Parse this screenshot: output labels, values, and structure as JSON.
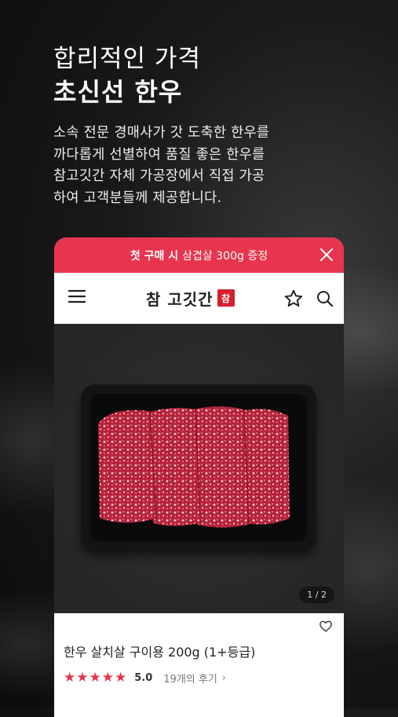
{
  "hero": {
    "subtitle": "합리적인 가격",
    "title": "초신선 한우",
    "description": [
      "소속 전문 경매사가 갓 도축한 한우를",
      "까다롭게 선별하여 품질 좋은 한우를",
      "참고깃간 자체 가공장에서 직접 가공",
      "하여 고객분들께 제공합니다."
    ]
  },
  "promo": {
    "bold": "첫 구매 시",
    "text": "삼겹살 300g 증정"
  },
  "header": {
    "logo_text": "참 고깃간",
    "logo_seal": "참"
  },
  "product": {
    "page_indicator": "1 / 2",
    "name": "한우 살치살 구이용 200g (1+등급)",
    "rating": "5.0",
    "stars": 5,
    "reviews": "19개의 후기",
    "chevron": "›"
  },
  "colors": {
    "accent": "#e8344e",
    "seal": "#d61f2c"
  }
}
